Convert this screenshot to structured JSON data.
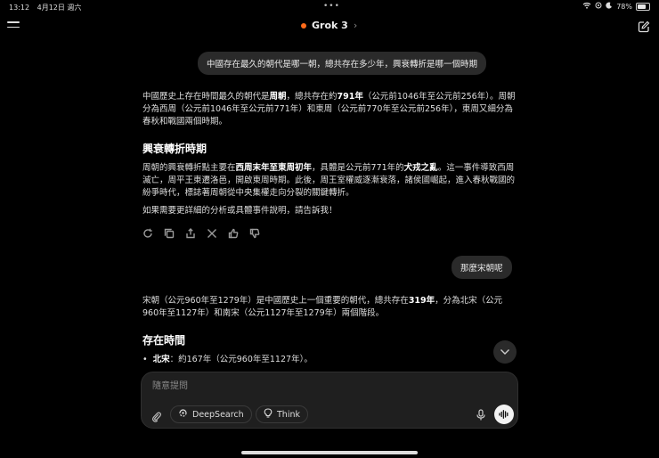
{
  "status_bar": {
    "time": "13:12",
    "date": "4月12日 週六",
    "battery": "78%",
    "battery_level": 0.78
  },
  "header": {
    "model_name": "Grok 3",
    "accent_color": "#ff6b1a"
  },
  "messages": {
    "user_1": "中國存在最久的朝代是哪一朝，總共存在多少年，興衰轉折是哪一個時期",
    "answer_1": {
      "intro": [
        "中國歷史上存在時間最久的朝代是",
        "周朝",
        "，總共存在約",
        "791年",
        "（公元前1046年至公元前256年）。周朝分為西周（公元前1046年至公元前771年）和東周（公元前770年至公元前256年），東周又細分為春秋和戰國兩個時期。"
      ],
      "heading": "興衰轉折時期",
      "body": [
        "周朝的興衰轉折點主要在",
        "西周末年至東周初年",
        "，具體是公元前771年的",
        "犬戎之亂",
        "。這一事件導致西周滅亡，周平王東遷洛邑，開啟東周時期。此後，周王室權威逐漸衰落，諸侯國崛起，進入春秋戰國的紛爭時代，標誌著周朝從中央集權走向分裂的關鍵轉折。"
      ],
      "closing": "如果需要更詳細的分析或具體事件說明，請告訴我！"
    },
    "user_2": "那麼宋朝呢",
    "answer_2": {
      "intro": [
        "宋朝（公元960年至1279年）是中國歷史上一個重要的朝代，總共存在",
        "319年",
        "，分為北宋（公元960年至1127年）和南宋（公元1127年至1279年）兩個階段。"
      ],
      "heading": "存在時間",
      "bullet_label": "北宋",
      "bullet_text": "：約167年（公元960年至1127年）。"
    }
  },
  "composer": {
    "placeholder": "隨意提問",
    "deepsearch_label": "DeepSearch",
    "think_label": "Think"
  }
}
